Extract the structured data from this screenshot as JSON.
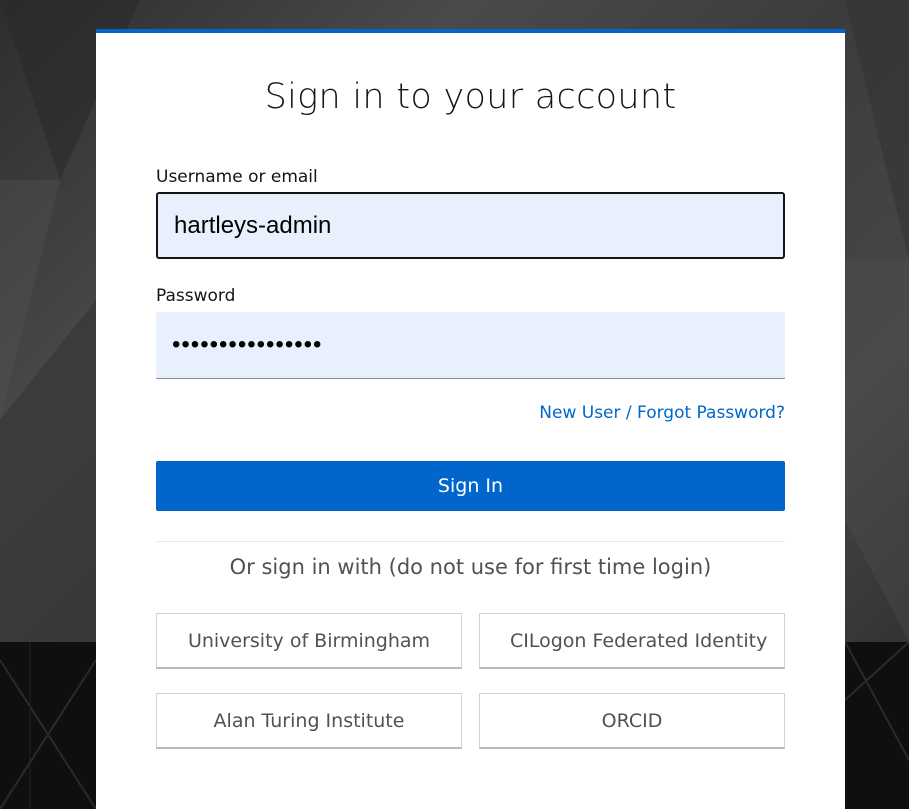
{
  "login": {
    "title": "Sign in to your account",
    "username_label": "Username or email",
    "username_value": "hartleys-admin",
    "password_label": "Password",
    "password_value": "••••••••••••••••",
    "forgot_link": "New User / Forgot Password?",
    "signin_button": "Sign In"
  },
  "identity_providers": {
    "heading": "Or sign in with (do not use for first time login)",
    "providers": [
      {
        "label": "University of Birmingham"
      },
      {
        "label": "CILogon Federated Identity"
      },
      {
        "label": "Alan Turing Institute"
      },
      {
        "label": "ORCID"
      }
    ]
  },
  "colors": {
    "accent": "#0066cc",
    "autofill_background": "#e8f0fe",
    "text_primary": "#151515",
    "text_secondary": "#4f5255"
  }
}
